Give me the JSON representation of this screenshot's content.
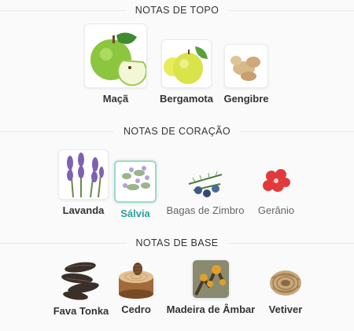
{
  "sections": {
    "top": {
      "title": "NOTAS DE TOPO",
      "items": [
        {
          "label": "Maçã",
          "icon": "green-apple-icon"
        },
        {
          "label": "Bergamota",
          "icon": "bergamot-icon"
        },
        {
          "label": "Gengibre",
          "icon": "ginger-icon"
        }
      ]
    },
    "heart": {
      "title": "NOTAS DE CORAÇÃO",
      "items": [
        {
          "label": "Lavanda",
          "icon": "lavender-icon"
        },
        {
          "label": "Sálvia",
          "icon": "sage-icon",
          "selected": true
        },
        {
          "label": "Bagas de Zimbro",
          "icon": "juniper-berries-icon"
        },
        {
          "label": "Gerânio",
          "icon": "geranium-icon"
        }
      ]
    },
    "base": {
      "title": "NOTAS DE BASE",
      "items": [
        {
          "label": "Fava Tonka",
          "icon": "tonka-bean-icon"
        },
        {
          "label": "Cedro",
          "icon": "cedar-icon"
        },
        {
          "label": "Madeira de Âmbar",
          "icon": "amber-wood-icon"
        },
        {
          "label": "Vetiver",
          "icon": "vetiver-icon"
        }
      ]
    }
  },
  "colors": {
    "accent": "#2aa198",
    "text": "#333333",
    "muted": "#666666"
  }
}
